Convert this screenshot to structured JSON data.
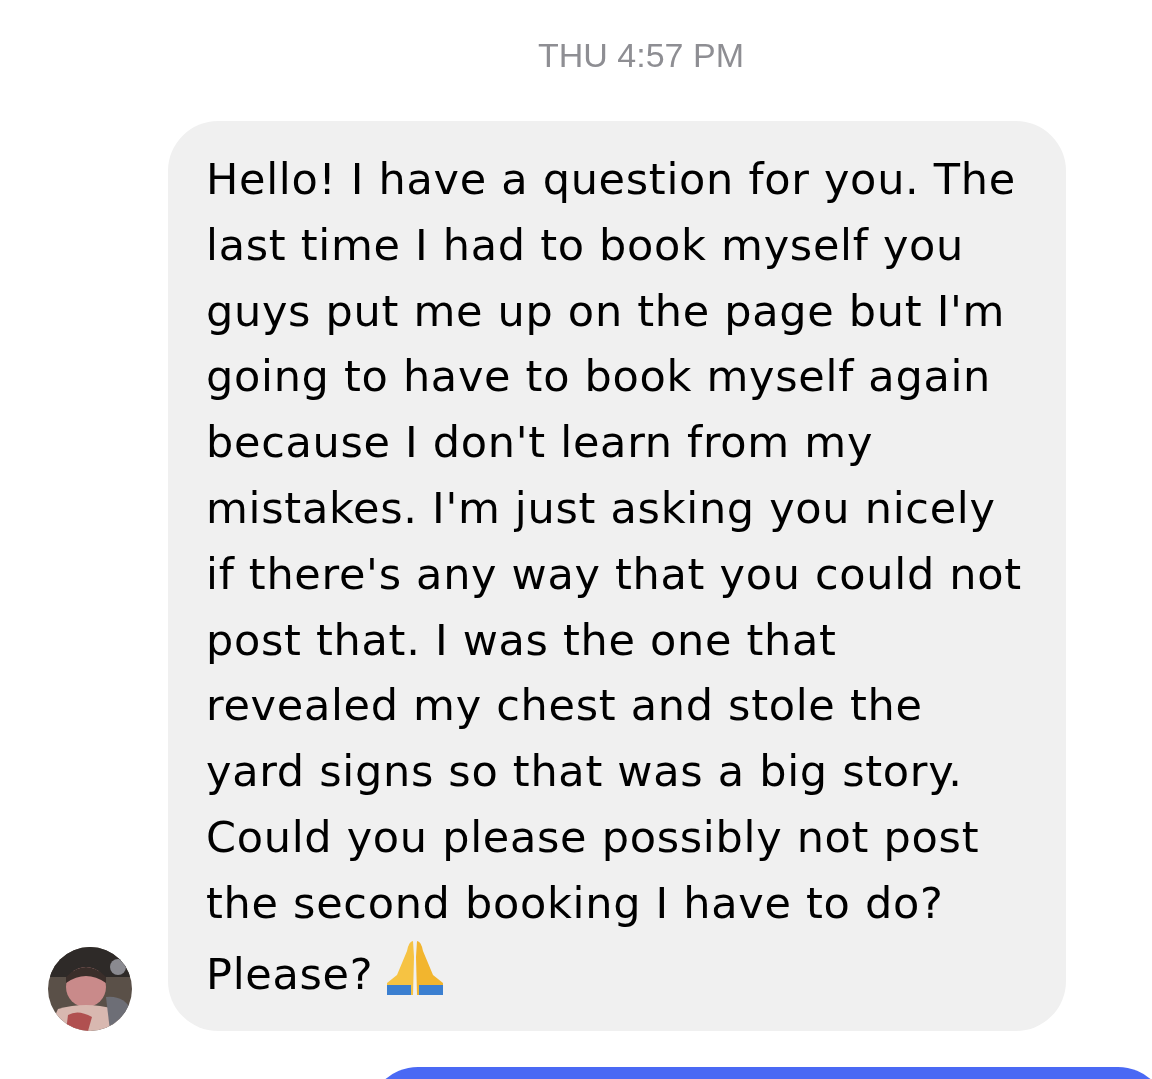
{
  "timestamp": "THU 4:57 PM",
  "messages": [
    {
      "kind": "received",
      "text": "Hello! I have a question for you. The last time I had to book myself you guys put me up on the page but I'm going to have to book myself again because I don't learn from my mistakes. I'm just asking you nicely if there's any way that you could not post that. I was the one that revealed my chest and stole the yard signs so that was a big story. Could you please possibly not post the second booking I have to do? Please?",
      "trailing_icon": true
    },
    {
      "kind": "sent"
    }
  ]
}
